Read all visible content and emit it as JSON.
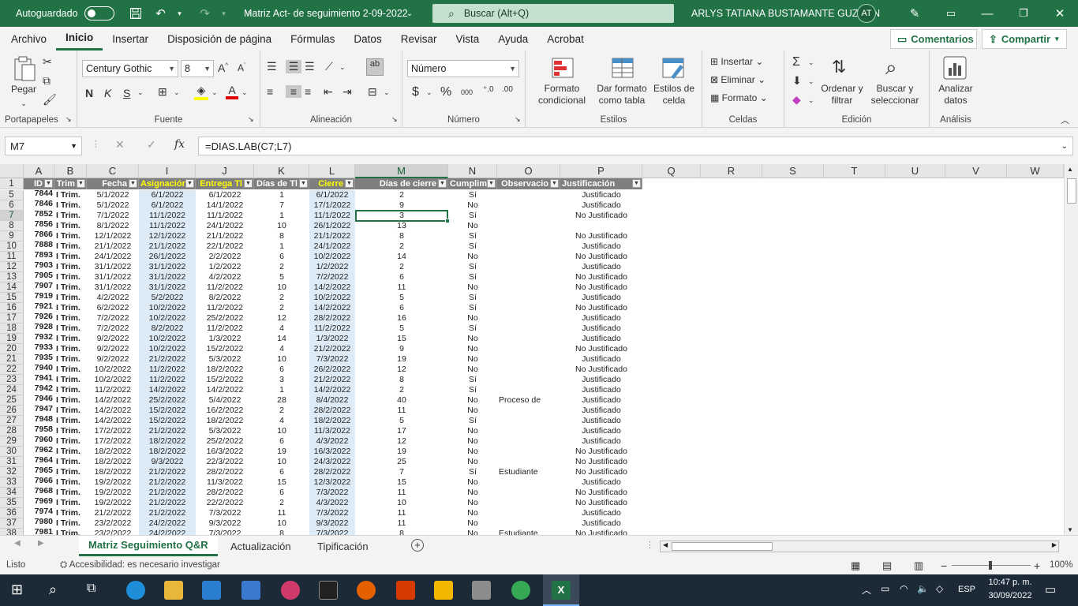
{
  "title_bar": {
    "autosave_label": "Autoguardado",
    "file_title": "Matriz Act- de seguimiento 2-09-2022",
    "search_placeholder": "Buscar (Alt+Q)",
    "user_name": "ARLYS TATIANA BUSTAMANTE GUZMAN",
    "user_initials": "AT"
  },
  "menu": {
    "tabs": [
      "Archivo",
      "Inicio",
      "Insertar",
      "Disposición de página",
      "Fórmulas",
      "Datos",
      "Revisar",
      "Vista",
      "Ayuda",
      "Acrobat"
    ],
    "active": "Inicio",
    "comments_label": "Comentarios",
    "share_label": "Compartir"
  },
  "ribbon": {
    "clipboard": {
      "paste": "Pegar",
      "label": "Portapapeles"
    },
    "font": {
      "name": "Century Gothic",
      "size": "8",
      "bold": "N",
      "italic": "K",
      "underline": "S",
      "label": "Fuente"
    },
    "alignment": {
      "label": "Alineación"
    },
    "number": {
      "format": "Número",
      "label": "Número"
    },
    "styles": {
      "cond_format": "Formato condicional",
      "table_format": "Dar formato como tabla",
      "cell_styles": "Estilos de celda",
      "label": "Estilos"
    },
    "cells": {
      "insert": "Insertar",
      "delete": "Eliminar",
      "format": "Formato",
      "label": "Celdas"
    },
    "editing": {
      "sort": "Ordenar y filtrar",
      "find": "Buscar y seleccionar",
      "label": "Edición"
    },
    "analysis": {
      "analyze": "Analizar datos",
      "label": "Análisis"
    }
  },
  "formula_bar": {
    "name_box": "M7",
    "formula": "=DIAS.LAB(C7;L7)",
    "fx": "fx"
  },
  "columns": [
    "A",
    "B",
    "C",
    "I",
    "J",
    "K",
    "L",
    "M",
    "N",
    "O",
    "P",
    "Q",
    "R",
    "S",
    "T",
    "U",
    "V",
    "W"
  ],
  "table_headers": [
    "ID",
    "Trim",
    "Fecha",
    "Asignación",
    "Entrega Tl",
    "Días de Tl",
    "Cierre",
    "Días de cierre",
    "Cumplim",
    "Observacio",
    "Justificación"
  ],
  "rows": [
    {
      "r": "5",
      "id": "7844",
      "trim": "I Trim.",
      "fecha": "5/1/2022",
      "asig": "6/1/2022",
      "entrega": "6/1/2022",
      "dias_tl": "1",
      "cierre": "6/1/2022",
      "dias_cierre": "2",
      "cumpl": "Sí",
      "obs": "",
      "just": "Justificado"
    },
    {
      "r": "6",
      "id": "7846",
      "trim": "I Trim.",
      "fecha": "5/1/2022",
      "asig": "6/1/2022",
      "entrega": "14/1/2022",
      "dias_tl": "7",
      "cierre": "17/1/2022",
      "dias_cierre": "9",
      "cumpl": "No",
      "obs": "",
      "just": "Justificado"
    },
    {
      "r": "7",
      "id": "7852",
      "trim": "I Trim.",
      "fecha": "7/1/2022",
      "asig": "11/1/2022",
      "entrega": "11/1/2022",
      "dias_tl": "1",
      "cierre": "11/1/2022",
      "dias_cierre": "3",
      "cumpl": "Sí",
      "obs": "",
      "just": "No Justificado"
    },
    {
      "r": "8",
      "id": "7856",
      "trim": "I Trim.",
      "fecha": "8/1/2022",
      "asig": "11/1/2022",
      "entrega": "24/1/2022",
      "dias_tl": "10",
      "cierre": "26/1/2022",
      "dias_cierre": "13",
      "cumpl": "No",
      "obs": "",
      "just": ""
    },
    {
      "r": "9",
      "id": "7866",
      "trim": "I Trim.",
      "fecha": "12/1/2022",
      "asig": "12/1/2022",
      "entrega": "21/1/2022",
      "dias_tl": "8",
      "cierre": "21/1/2022",
      "dias_cierre": "8",
      "cumpl": "Sí",
      "obs": "",
      "just": "No Justificado"
    },
    {
      "r": "10",
      "id": "7888",
      "trim": "I Trim.",
      "fecha": "21/1/2022",
      "asig": "21/1/2022",
      "entrega": "22/1/2022",
      "dias_tl": "1",
      "cierre": "24/1/2022",
      "dias_cierre": "2",
      "cumpl": "Sí",
      "obs": "",
      "just": "Justificado"
    },
    {
      "r": "11",
      "id": "7893",
      "trim": "I Trim.",
      "fecha": "24/1/2022",
      "asig": "26/1/2022",
      "entrega": "2/2/2022",
      "dias_tl": "6",
      "cierre": "10/2/2022",
      "dias_cierre": "14",
      "cumpl": "No",
      "obs": "",
      "just": "No Justificado"
    },
    {
      "r": "12",
      "id": "7903",
      "trim": "I Trim.",
      "fecha": "31/1/2022",
      "asig": "31/1/2022",
      "entrega": "1/2/2022",
      "dias_tl": "2",
      "cierre": "1/2/2022",
      "dias_cierre": "2",
      "cumpl": "Sí",
      "obs": "",
      "just": "Justificado"
    },
    {
      "r": "13",
      "id": "7905",
      "trim": "I Trim.",
      "fecha": "31/1/2022",
      "asig": "31/1/2022",
      "entrega": "4/2/2022",
      "dias_tl": "5",
      "cierre": "7/2/2022",
      "dias_cierre": "6",
      "cumpl": "Sí",
      "obs": "",
      "just": "No Justificado"
    },
    {
      "r": "14",
      "id": "7907",
      "trim": "I Trim.",
      "fecha": "31/1/2022",
      "asig": "31/1/2022",
      "entrega": "11/2/2022",
      "dias_tl": "10",
      "cierre": "14/2/2022",
      "dias_cierre": "11",
      "cumpl": "No",
      "obs": "",
      "just": "No Justificado"
    },
    {
      "r": "15",
      "id": "7919",
      "trim": "I Trim.",
      "fecha": "4/2/2022",
      "asig": "5/2/2022",
      "entrega": "8/2/2022",
      "dias_tl": "2",
      "cierre": "10/2/2022",
      "dias_cierre": "5",
      "cumpl": "Sí",
      "obs": "",
      "just": "Justificado"
    },
    {
      "r": "16",
      "id": "7921",
      "trim": "I Trim.",
      "fecha": "6/2/2022",
      "asig": "10/2/2022",
      "entrega": "11/2/2022",
      "dias_tl": "2",
      "cierre": "14/2/2022",
      "dias_cierre": "6",
      "cumpl": "Sí",
      "obs": "",
      "just": "No Justificado"
    },
    {
      "r": "17",
      "id": "7926",
      "trim": "I Trim.",
      "fecha": "7/2/2022",
      "asig": "10/2/2022",
      "entrega": "25/2/2022",
      "dias_tl": "12",
      "cierre": "28/2/2022",
      "dias_cierre": "16",
      "cumpl": "No",
      "obs": "",
      "just": "Justificado"
    },
    {
      "r": "18",
      "id": "7928",
      "trim": "I Trim.",
      "fecha": "7/2/2022",
      "asig": "8/2/2022",
      "entrega": "11/2/2022",
      "dias_tl": "4",
      "cierre": "11/2/2022",
      "dias_cierre": "5",
      "cumpl": "Sí",
      "obs": "",
      "just": "Justificado"
    },
    {
      "r": "19",
      "id": "7932",
      "trim": "I Trim.",
      "fecha": "9/2/2022",
      "asig": "10/2/2022",
      "entrega": "1/3/2022",
      "dias_tl": "14",
      "cierre": "1/3/2022",
      "dias_cierre": "15",
      "cumpl": "No",
      "obs": "",
      "just": "Justificado"
    },
    {
      "r": "20",
      "id": "7933",
      "trim": "I Trim.",
      "fecha": "9/2/2022",
      "asig": "10/2/2022",
      "entrega": "15/2/2022",
      "dias_tl": "4",
      "cierre": "21/2/2022",
      "dias_cierre": "9",
      "cumpl": "No",
      "obs": "",
      "just": "No Justificado"
    },
    {
      "r": "21",
      "id": "7935",
      "trim": "I Trim.",
      "fecha": "9/2/2022",
      "asig": "21/2/2022",
      "entrega": "5/3/2022",
      "dias_tl": "10",
      "cierre": "7/3/2022",
      "dias_cierre": "19",
      "cumpl": "No",
      "obs": "",
      "just": "Justificado"
    },
    {
      "r": "22",
      "id": "7940",
      "trim": "I Trim.",
      "fecha": "10/2/2022",
      "asig": "11/2/2022",
      "entrega": "18/2/2022",
      "dias_tl": "6",
      "cierre": "26/2/2022",
      "dias_cierre": "12",
      "cumpl": "No",
      "obs": "",
      "just": "No Justificado"
    },
    {
      "r": "23",
      "id": "7941",
      "trim": "I Trim.",
      "fecha": "10/2/2022",
      "asig": "11/2/2022",
      "entrega": "15/2/2022",
      "dias_tl": "3",
      "cierre": "21/2/2022",
      "dias_cierre": "8",
      "cumpl": "Sí",
      "obs": "",
      "just": "Justificado"
    },
    {
      "r": "24",
      "id": "7942",
      "trim": "I Trim.",
      "fecha": "11/2/2022",
      "asig": "14/2/2022",
      "entrega": "14/2/2022",
      "dias_tl": "1",
      "cierre": "14/2/2022",
      "dias_cierre": "2",
      "cumpl": "Sí",
      "obs": "",
      "just": "Justificado"
    },
    {
      "r": "25",
      "id": "7946",
      "trim": "I Trim.",
      "fecha": "14/2/2022",
      "asig": "25/2/2022",
      "entrega": "5/4/2022",
      "dias_tl": "28",
      "cierre": "8/4/2022",
      "dias_cierre": "40",
      "cumpl": "No",
      "obs": "Proceso de",
      "just": "Justificado"
    },
    {
      "r": "26",
      "id": "7947",
      "trim": "I Trim.",
      "fecha": "14/2/2022",
      "asig": "15/2/2022",
      "entrega": "16/2/2022",
      "dias_tl": "2",
      "cierre": "28/2/2022",
      "dias_cierre": "11",
      "cumpl": "No",
      "obs": "",
      "just": "Justificado"
    },
    {
      "r": "27",
      "id": "7948",
      "trim": "I Trim.",
      "fecha": "14/2/2022",
      "asig": "15/2/2022",
      "entrega": "18/2/2022",
      "dias_tl": "4",
      "cierre": "18/2/2022",
      "dias_cierre": "5",
      "cumpl": "Sí",
      "obs": "",
      "just": "Justificado"
    },
    {
      "r": "28",
      "id": "7958",
      "trim": "I Trim.",
      "fecha": "17/2/2022",
      "asig": "21/2/2022",
      "entrega": "5/3/2022",
      "dias_tl": "10",
      "cierre": "11/3/2022",
      "dias_cierre": "17",
      "cumpl": "No",
      "obs": "",
      "just": "Justificado"
    },
    {
      "r": "29",
      "id": "7960",
      "trim": "I Trim.",
      "fecha": "17/2/2022",
      "asig": "18/2/2022",
      "entrega": "25/2/2022",
      "dias_tl": "6",
      "cierre": "4/3/2022",
      "dias_cierre": "12",
      "cumpl": "No",
      "obs": "",
      "just": "Justificado"
    },
    {
      "r": "30",
      "id": "7962",
      "trim": "I Trim.",
      "fecha": "18/2/2022",
      "asig": "18/2/2022",
      "entrega": "16/3/2022",
      "dias_tl": "19",
      "cierre": "16/3/2022",
      "dias_cierre": "19",
      "cumpl": "No",
      "obs": "",
      "just": "No Justificado"
    },
    {
      "r": "31",
      "id": "7964",
      "trim": "I Trim.",
      "fecha": "18/2/2022",
      "asig": "9/3/2022",
      "entrega": "22/3/2022",
      "dias_tl": "10",
      "cierre": "24/3/2022",
      "dias_cierre": "25",
      "cumpl": "No",
      "obs": "",
      "just": "No Justificado"
    },
    {
      "r": "32",
      "id": "7965",
      "trim": "I Trim.",
      "fecha": "18/2/2022",
      "asig": "21/2/2022",
      "entrega": "28/2/2022",
      "dias_tl": "6",
      "cierre": "28/2/2022",
      "dias_cierre": "7",
      "cumpl": "Sí",
      "obs": "Estudiante",
      "just": "No Justificado"
    },
    {
      "r": "33",
      "id": "7966",
      "trim": "I Trim.",
      "fecha": "19/2/2022",
      "asig": "21/2/2022",
      "entrega": "11/3/2022",
      "dias_tl": "15",
      "cierre": "12/3/2022",
      "dias_cierre": "15",
      "cumpl": "No",
      "obs": "",
      "just": "Justificado"
    },
    {
      "r": "34",
      "id": "7968",
      "trim": "I Trim.",
      "fecha": "19/2/2022",
      "asig": "21/2/2022",
      "entrega": "28/2/2022",
      "dias_tl": "6",
      "cierre": "7/3/2022",
      "dias_cierre": "11",
      "cumpl": "No",
      "obs": "",
      "just": "No Justificado"
    },
    {
      "r": "35",
      "id": "7969",
      "trim": "I Trim.",
      "fecha": "19/2/2022",
      "asig": "21/2/2022",
      "entrega": "22/2/2022",
      "dias_tl": "2",
      "cierre": "4/3/2022",
      "dias_cierre": "10",
      "cumpl": "No",
      "obs": "",
      "just": "No Justificado"
    },
    {
      "r": "36",
      "id": "7974",
      "trim": "I Trim.",
      "fecha": "21/2/2022",
      "asig": "21/2/2022",
      "entrega": "7/3/2022",
      "dias_tl": "11",
      "cierre": "7/3/2022",
      "dias_cierre": "11",
      "cumpl": "No",
      "obs": "",
      "just": "Justificado"
    },
    {
      "r": "37",
      "id": "7980",
      "trim": "I Trim.",
      "fecha": "23/2/2022",
      "asig": "24/2/2022",
      "entrega": "9/3/2022",
      "dias_tl": "10",
      "cierre": "9/3/2022",
      "dias_cierre": "11",
      "cumpl": "No",
      "obs": "",
      "just": "Justificado"
    },
    {
      "r": "38",
      "id": "7981",
      "trim": "I Trim.",
      "fecha": "23/2/2022",
      "asig": "24/2/2022",
      "entrega": "7/3/2022",
      "dias_tl": "8",
      "cierre": "7/3/2022",
      "dias_cierre": "8",
      "cumpl": "No",
      "obs": "Estudiante",
      "just": "No Justificado"
    }
  ],
  "sheets": {
    "tabs": [
      "Matriz Seguimiento Q&R",
      "Actualización",
      "Tipificación"
    ],
    "active": "Matriz Seguimiento Q&R"
  },
  "status": {
    "ready": "Listo",
    "accessibility": "Accesibilidad: es necesario investigar",
    "zoom": "100%"
  },
  "taskbar": {
    "lang": "ESP",
    "time": "10:47 p. m.",
    "date": "30/09/2022"
  }
}
